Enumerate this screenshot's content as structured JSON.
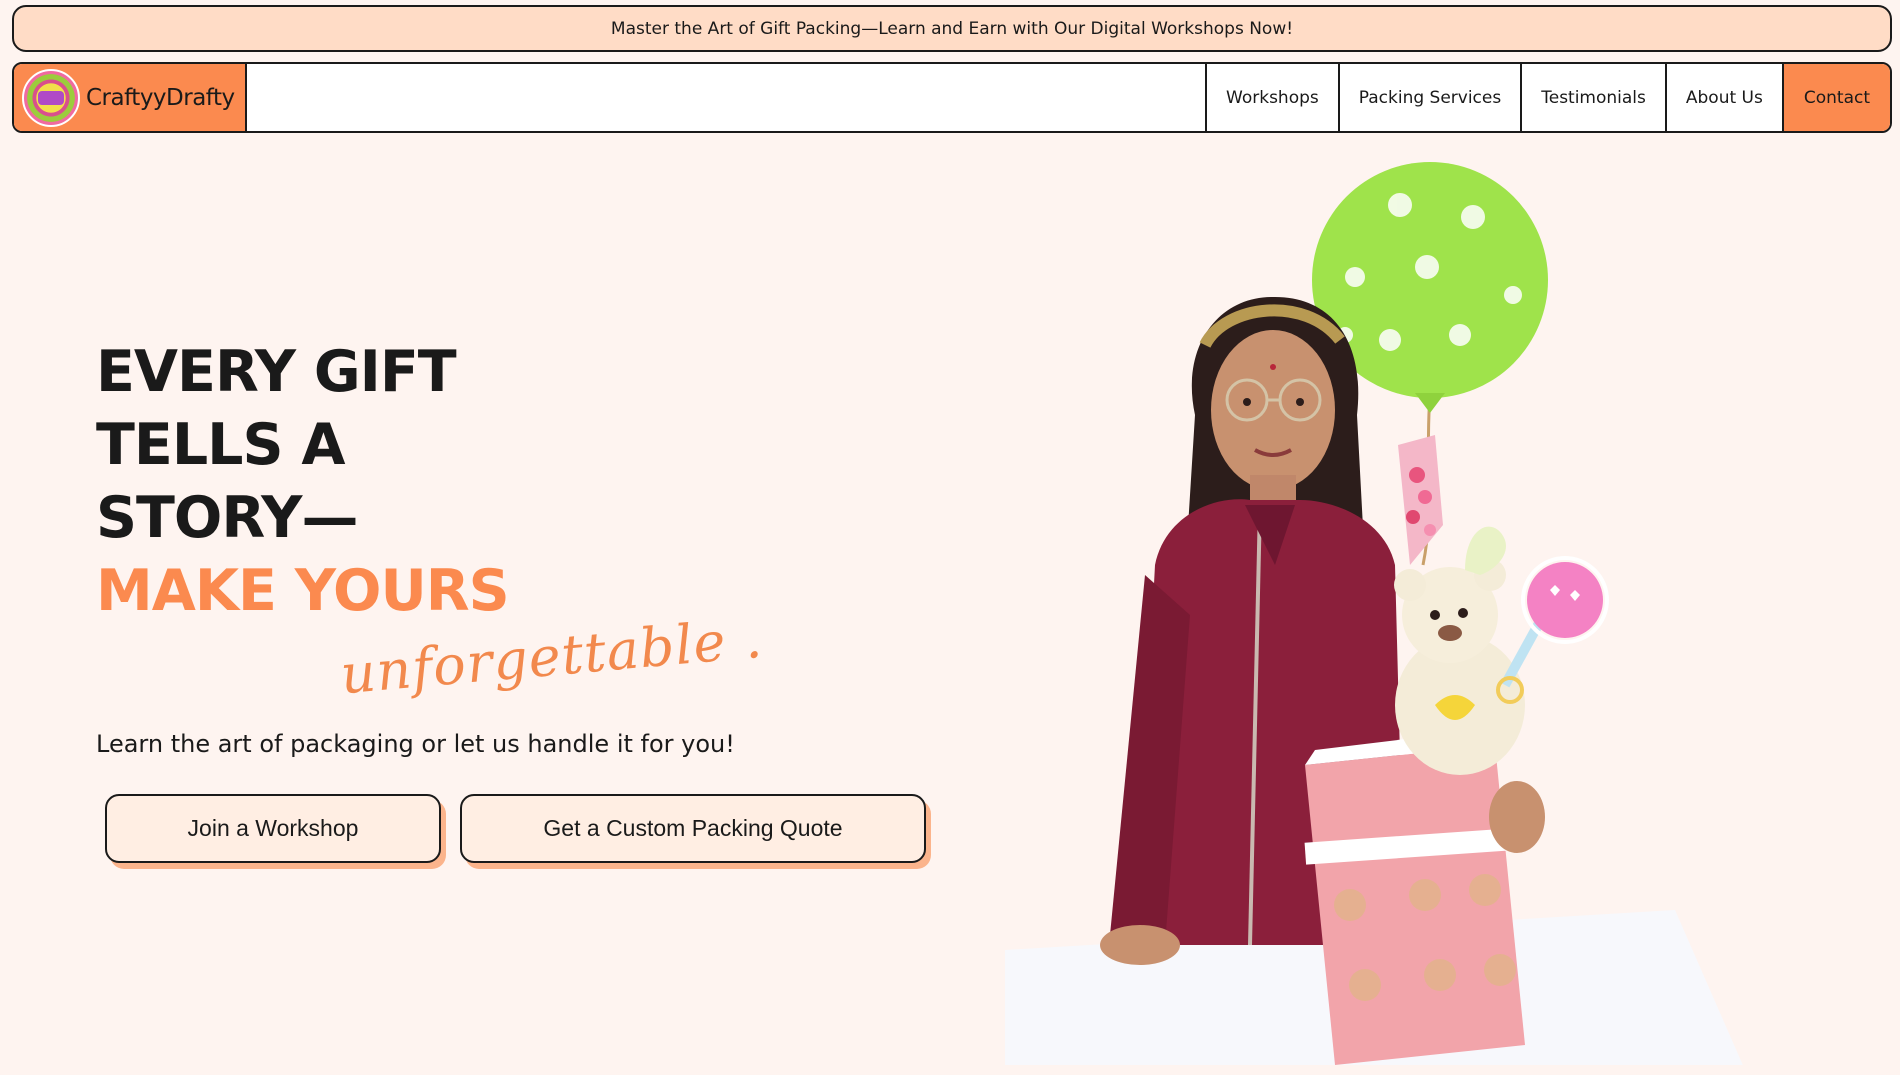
{
  "announcement": {
    "text": "Master the Art of Gift Packing—Learn and Earn with Our Digital Workshops Now!"
  },
  "brand": {
    "name": "CraftyyDrafty",
    "logo_icon": "brand-logo-icon"
  },
  "nav": {
    "items": [
      {
        "label": "Workshops"
      },
      {
        "label": "Packing Services"
      },
      {
        "label": "Testimonials"
      },
      {
        "label": "About Us"
      },
      {
        "label": "Contact"
      }
    ]
  },
  "hero": {
    "headline_lines": [
      "EVERY GIFT",
      "TELLS A",
      "STORY—"
    ],
    "headline_accent": "MAKE YOURS",
    "script_word": "unforgettable .",
    "subline": "Learn the art of packaging or let us handle it for you!",
    "buttons": {
      "join": "Join a Workshop",
      "quote": "Get a Custom Packing Quote"
    }
  },
  "colors": {
    "accent": "#fb8a4f",
    "background": "#fef4f0",
    "announcement_bg": "#ffdcc6",
    "button_bg": "#ffeee3",
    "button_shadow": "#fbb48c"
  }
}
